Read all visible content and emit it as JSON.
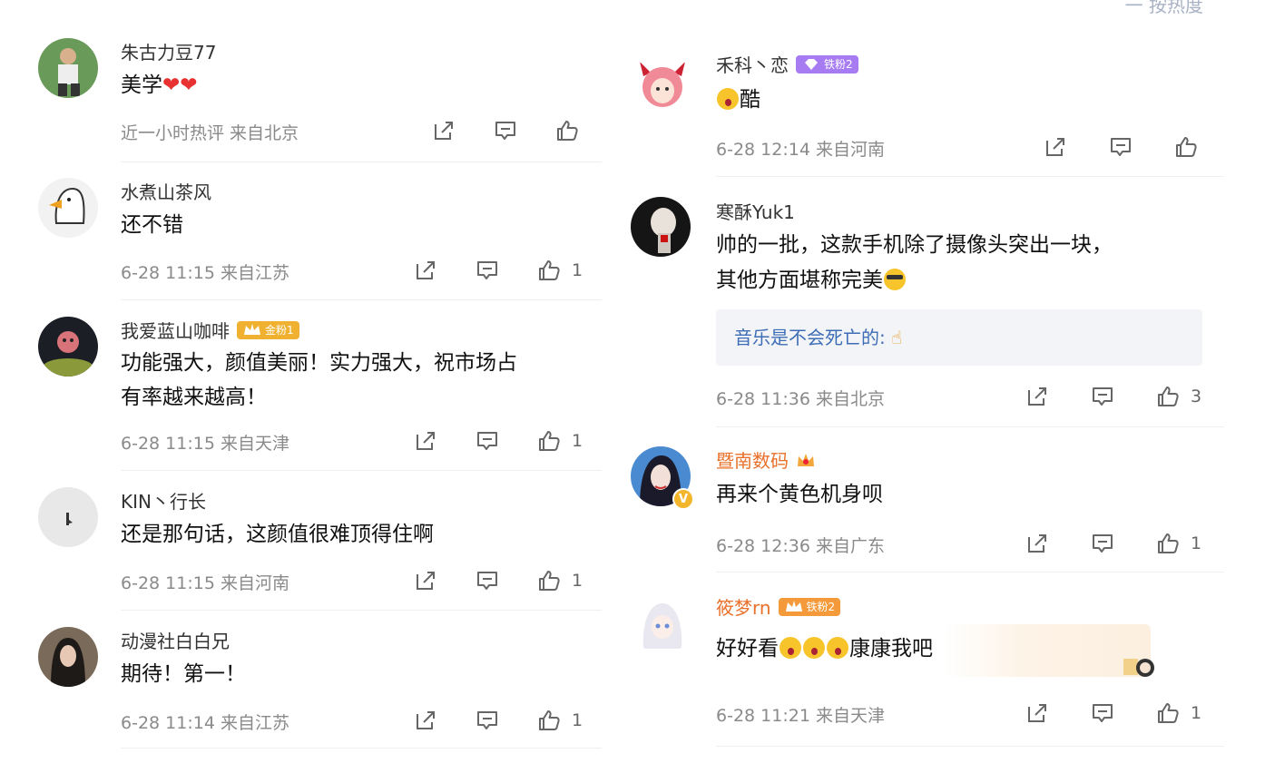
{
  "left": [
    {
      "name": "朱古力豆77",
      "badge": null,
      "text": "美学",
      "hearts": "❤❤",
      "meta": "近一小时热评  来自北京",
      "likes": null
    },
    {
      "name": "水煮山茶风",
      "badge": null,
      "text": "还不错",
      "meta": "6-28 11:15  来自江苏",
      "likes": "1"
    },
    {
      "name": "我爱蓝山咖啡",
      "badge": "金粉1",
      "text_lines": [
        "功能强大，颜值美丽！实力强大，祝市场占",
        "有率越来越高！"
      ],
      "meta": "6-28 11:15  来自天津",
      "likes": "1"
    },
    {
      "name": "KIN丶行长",
      "badge": null,
      "text": "还是那句话，这颜值很难顶得住啊",
      "meta": "6-28 11:15  来自河南",
      "likes": "1"
    },
    {
      "name": "动漫社白白兄",
      "badge": null,
      "text": "期待！第一！",
      "meta": "6-28 11:14  来自江苏",
      "likes": "1"
    }
  ],
  "right": [
    {
      "name": "禾科丶恋",
      "badge": "铁粉2",
      "text": "酷",
      "meta": "6-28 12:14  来自河南",
      "likes": null
    },
    {
      "name": "寒酥Yuk1",
      "badge": null,
      "text_lines": [
        "帅的一批，这款手机除了摄像头突出一块，",
        "其他方面堪称完美"
      ],
      "quote": "音乐是不会死亡的:",
      "meta": "6-28 11:36  来自北京",
      "likes": "3"
    },
    {
      "name": "暨南数码",
      "badge": null,
      "text": "再来个黄色机身呗",
      "meta": "6-28 12:36  来自广东",
      "likes": "1"
    },
    {
      "name": "筱梦rn",
      "badge": "铁粉2",
      "text": "好好看",
      "text_after": "康康我吧",
      "meta": "6-28 11:21  来自天津",
      "likes": "1"
    }
  ],
  "top_peek": "一  按热度",
  "icons": {
    "share": "share-icon",
    "comment": "comment-icon",
    "like": "like-icon"
  },
  "colors": {
    "name_orange": "#e8702a",
    "quote_link": "#3d6db5",
    "meta_gray": "#8a8a8a"
  }
}
